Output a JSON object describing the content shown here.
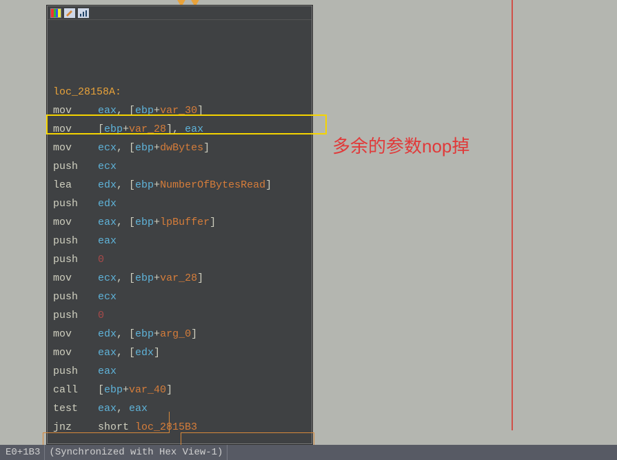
{
  "label": "loc_28158A:",
  "lines": [
    {
      "op": "mov",
      "parts": [
        {
          "t": "reg",
          "v": "eax"
        },
        {
          "t": "punc",
          "v": ", ["
        },
        {
          "t": "reg",
          "v": "ebp"
        },
        {
          "t": "punc",
          "v": "+"
        },
        {
          "t": "var",
          "v": "var_30"
        },
        {
          "t": "punc",
          "v": "]"
        }
      ]
    },
    {
      "op": "mov",
      "parts": [
        {
          "t": "punc",
          "v": "["
        },
        {
          "t": "reg",
          "v": "ebp"
        },
        {
          "t": "punc",
          "v": "+"
        },
        {
          "t": "var",
          "v": "var_28"
        },
        {
          "t": "punc",
          "v": "], "
        },
        {
          "t": "reg",
          "v": "eax"
        }
      ]
    },
    {
      "op": "mov",
      "parts": [
        {
          "t": "reg",
          "v": "ecx"
        },
        {
          "t": "punc",
          "v": ", ["
        },
        {
          "t": "reg",
          "v": "ebp"
        },
        {
          "t": "punc",
          "v": "+"
        },
        {
          "t": "var",
          "v": "dwBytes"
        },
        {
          "t": "punc",
          "v": "]"
        }
      ]
    },
    {
      "op": "push",
      "parts": [
        {
          "t": "reg",
          "v": "ecx"
        }
      ],
      "hl": true
    },
    {
      "op": "lea",
      "parts": [
        {
          "t": "reg",
          "v": "edx"
        },
        {
          "t": "punc",
          "v": ", ["
        },
        {
          "t": "reg",
          "v": "ebp"
        },
        {
          "t": "punc",
          "v": "+"
        },
        {
          "t": "var",
          "v": "NumberOfBytesRead"
        },
        {
          "t": "punc",
          "v": "]"
        }
      ]
    },
    {
      "op": "push",
      "parts": [
        {
          "t": "reg",
          "v": "edx"
        }
      ]
    },
    {
      "op": "mov",
      "parts": [
        {
          "t": "reg",
          "v": "eax"
        },
        {
          "t": "punc",
          "v": ", ["
        },
        {
          "t": "reg",
          "v": "ebp"
        },
        {
          "t": "punc",
          "v": "+"
        },
        {
          "t": "var",
          "v": "lpBuffer"
        },
        {
          "t": "punc",
          "v": "]"
        }
      ]
    },
    {
      "op": "push",
      "parts": [
        {
          "t": "reg",
          "v": "eax"
        }
      ]
    },
    {
      "op": "push",
      "parts": [
        {
          "t": "num",
          "v": "0"
        }
      ]
    },
    {
      "op": "mov",
      "parts": [
        {
          "t": "reg",
          "v": "ecx"
        },
        {
          "t": "punc",
          "v": ", ["
        },
        {
          "t": "reg",
          "v": "ebp"
        },
        {
          "t": "punc",
          "v": "+"
        },
        {
          "t": "var",
          "v": "var_28"
        },
        {
          "t": "punc",
          "v": "]"
        }
      ]
    },
    {
      "op": "push",
      "parts": [
        {
          "t": "reg",
          "v": "ecx"
        }
      ]
    },
    {
      "op": "push",
      "parts": [
        {
          "t": "num",
          "v": "0"
        }
      ]
    },
    {
      "op": "mov",
      "parts": [
        {
          "t": "reg",
          "v": "edx"
        },
        {
          "t": "punc",
          "v": ", ["
        },
        {
          "t": "reg",
          "v": "ebp"
        },
        {
          "t": "punc",
          "v": "+"
        },
        {
          "t": "var",
          "v": "arg_0"
        },
        {
          "t": "punc",
          "v": "]"
        }
      ]
    },
    {
      "op": "mov",
      "parts": [
        {
          "t": "reg",
          "v": "eax"
        },
        {
          "t": "punc",
          "v": ", ["
        },
        {
          "t": "reg",
          "v": "edx"
        },
        {
          "t": "punc",
          "v": "]"
        }
      ]
    },
    {
      "op": "push",
      "parts": [
        {
          "t": "reg",
          "v": "eax"
        }
      ]
    },
    {
      "op": "call",
      "parts": [
        {
          "t": "punc",
          "v": "["
        },
        {
          "t": "reg",
          "v": "ebp"
        },
        {
          "t": "punc",
          "v": "+"
        },
        {
          "t": "var",
          "v": "var_40"
        },
        {
          "t": "punc",
          "v": "]"
        }
      ]
    },
    {
      "op": "test",
      "parts": [
        {
          "t": "reg",
          "v": "eax"
        },
        {
          "t": "punc",
          "v": ", "
        },
        {
          "t": "reg",
          "v": "eax"
        }
      ]
    },
    {
      "op": "jnz",
      "parts": [
        {
          "t": "short",
          "v": "short "
        },
        {
          "t": "var",
          "v": "loc_2815B3"
        }
      ]
    }
  ],
  "annotation": "多余的参数nop掉",
  "status": {
    "pos": "E0+1B3",
    "sync": "(Synchronized with Hex View-1)"
  },
  "icons": {
    "palette": "palette-icon",
    "edit": "edit-icon",
    "graph": "graph-icon"
  }
}
